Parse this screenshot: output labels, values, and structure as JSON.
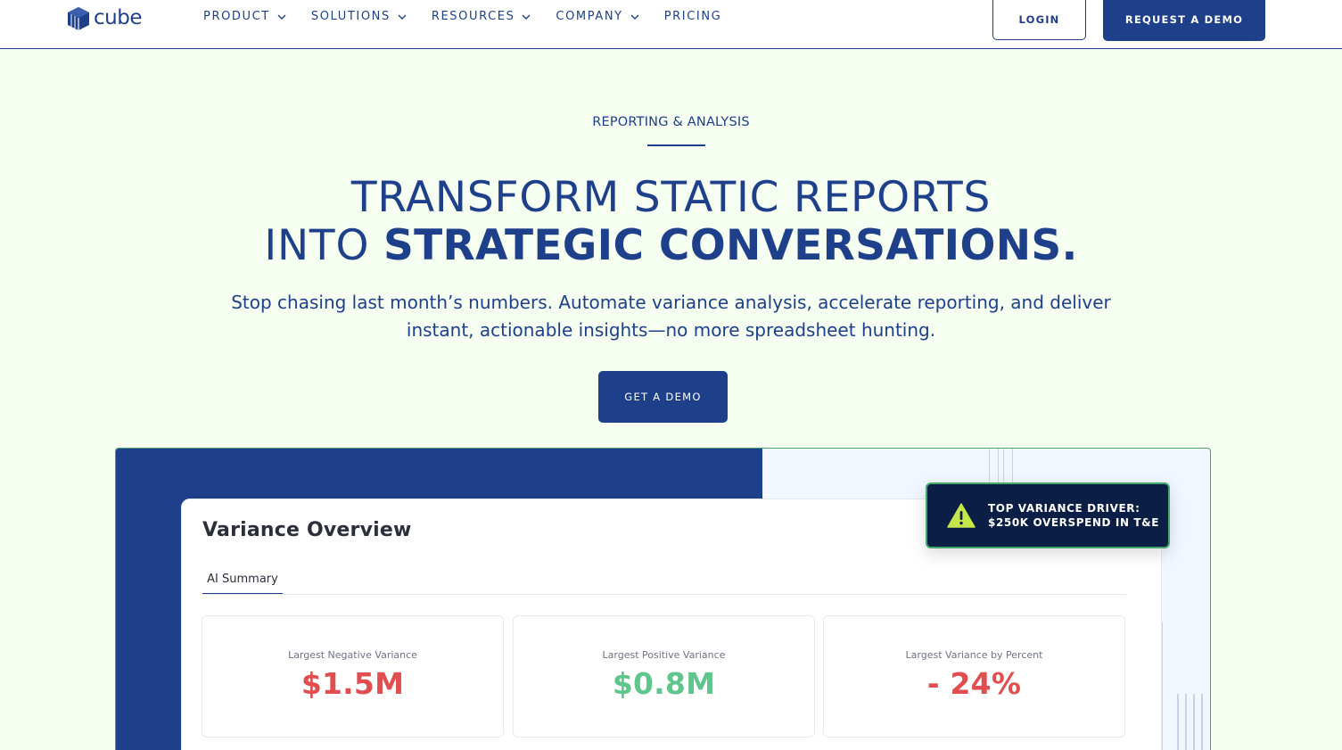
{
  "nav": {
    "logo_text": "cube",
    "items": [
      {
        "label": "PRODUCT",
        "has_dropdown": true
      },
      {
        "label": "SOLUTIONS",
        "has_dropdown": true
      },
      {
        "label": "RESOURCES",
        "has_dropdown": true
      },
      {
        "label": "COMPANY",
        "has_dropdown": true
      },
      {
        "label": "PRICING",
        "has_dropdown": false
      }
    ],
    "login_label": "LOGIN",
    "request_demo_label": "REQUEST A DEMO"
  },
  "hero": {
    "eyebrow": "REPORTING & ANALYSIS",
    "headline_line1": "TRANSFORM STATIC REPORTS",
    "headline_line2_light": "INTO ",
    "headline_line2_bold": "STRATEGIC CONVERSATIONS.",
    "subtitle": "Stop chasing last month’s numbers. Automate variance analysis, accelerate reporting, and deliver instant, actionable insights—no more spreadsheet hunting.",
    "cta_label": "GET A DEMO"
  },
  "preview": {
    "title": "Variance Overview",
    "tab_label": "AI Summary",
    "stats": [
      {
        "label": "Largest Negative Variance",
        "value": "$1.5M",
        "tone": "negative"
      },
      {
        "label": "Largest Positive Variance",
        "value": "$0.8M",
        "tone": "positive"
      },
      {
        "label": "Largest Variance by Percent",
        "value": "- 24%",
        "tone": "negative"
      }
    ],
    "alert": {
      "icon": "warning-icon",
      "line1": "TOP VARIANCE DRIVER:",
      "line2": "$250K OVERSPEND IN T&E"
    }
  },
  "colors": {
    "brand": "#1e3f8a",
    "background": "#f6fdf1",
    "negative": "#e04e50",
    "positive": "#5fc58c",
    "alert_bg": "#0b1f46",
    "alert_border": "#3fa86a",
    "warning": "#c6e64a"
  }
}
